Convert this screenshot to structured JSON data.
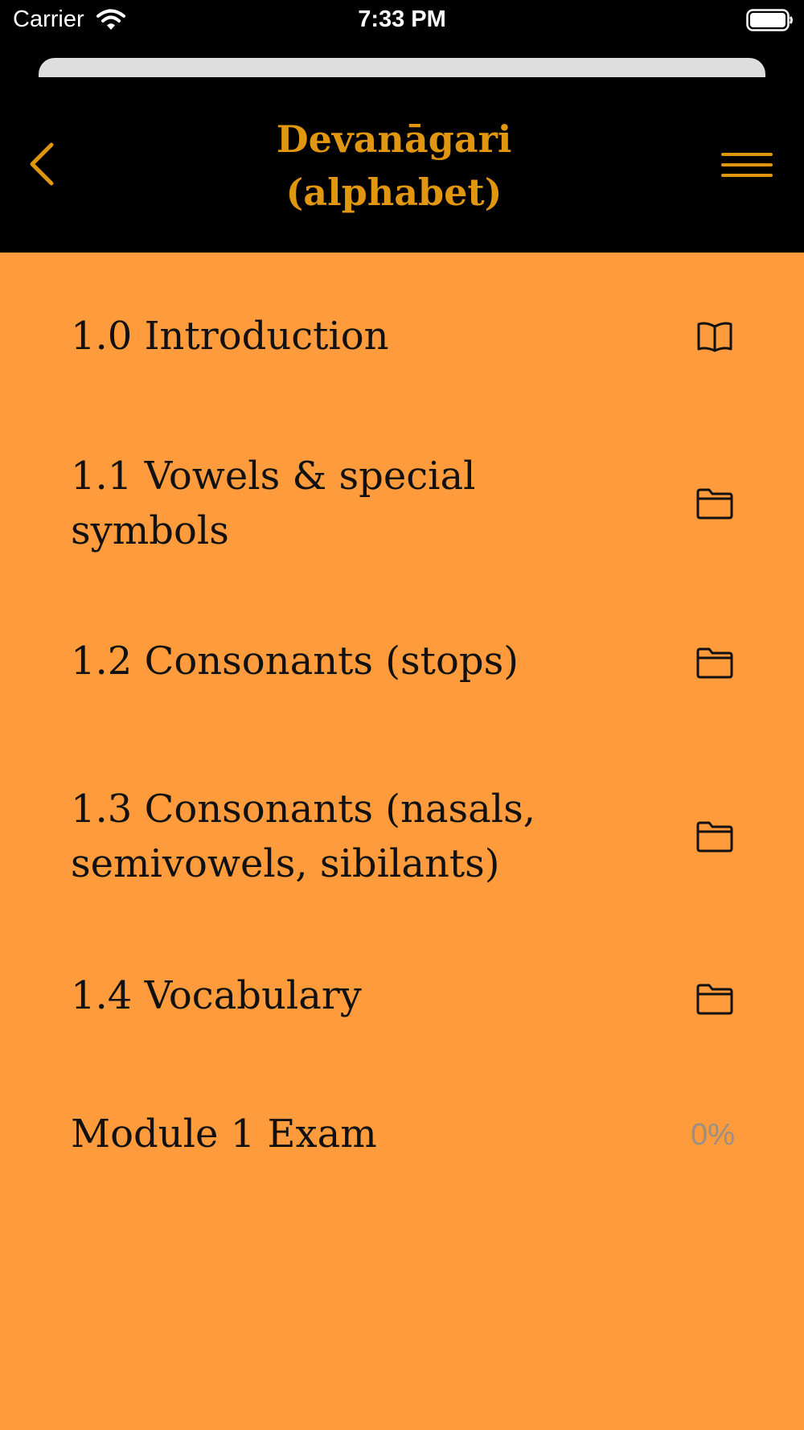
{
  "status_bar": {
    "carrier": "Carrier",
    "time": "7:33 PM",
    "wifi_icon": "wifi-icon",
    "battery_icon": "battery-icon"
  },
  "header": {
    "title_line1": "Devanāgari",
    "title_line2": "(alphabet)",
    "back_icon": "chevron-left-icon",
    "menu_icon": "hamburger-menu-icon",
    "accent_color": "#e0960e"
  },
  "list": {
    "background_color": "#fe9b3c",
    "items": [
      {
        "line1": "1.0 Introduction",
        "line2": "",
        "icon": "book-icon"
      },
      {
        "line1": "1.1 Vowels & special",
        "line2": "symbols",
        "icon": "folder-icon"
      },
      {
        "line1": "1.2 Consonants (stops)",
        "line2": "",
        "icon": "folder-icon"
      },
      {
        "line1": "1.3 Consonants (nasals,",
        "line2": "semivowels, sibilants)",
        "icon": "folder-icon"
      },
      {
        "line1": "1.4 Vocabulary",
        "line2": "",
        "icon": "folder-icon"
      }
    ],
    "exam": {
      "label": "Module 1 Exam",
      "progress": "0%"
    }
  }
}
